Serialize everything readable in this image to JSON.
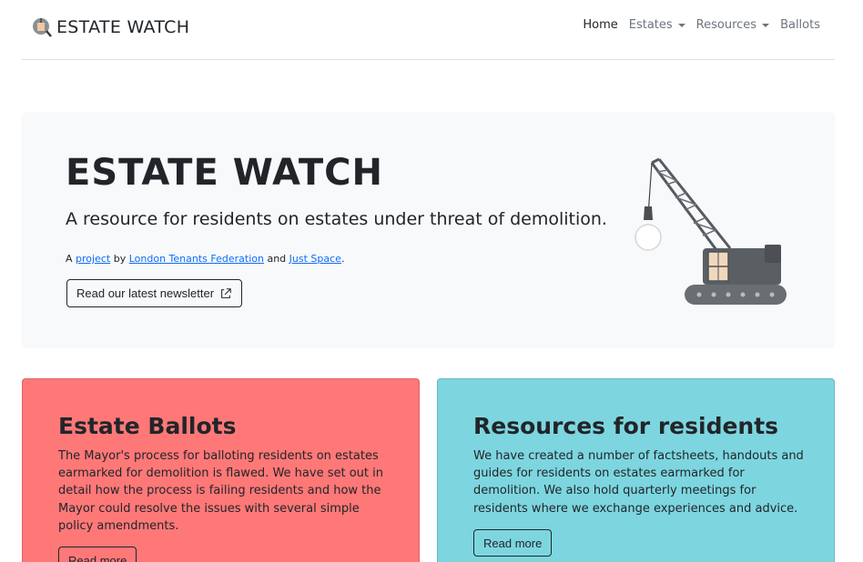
{
  "navbar": {
    "brand": "ESTATE WATCH",
    "items": [
      {
        "label": "Home"
      },
      {
        "label": "Estates"
      },
      {
        "label": "Resources"
      },
      {
        "label": "Ballots"
      }
    ]
  },
  "hero": {
    "title": "ESTATE WATCH",
    "lead": "A resource for residents on estates under threat of demolition.",
    "credit": {
      "prefix": "A",
      "link_project": "project",
      "by": "by",
      "link_ltf": "London Tenants Federation",
      "and": "and",
      "link_justspace": "Just Space",
      "suffix": "."
    },
    "newsletter_button": "Read our latest newsletter"
  },
  "cards": {
    "ballots": {
      "title": "Estate Ballots",
      "text": "The Mayor's process for balloting residents on estates earmarked for demolition is flawed. We have set out in detail how the process is failing residents and how the Mayor could resolve the issues with several simple policy amendments.",
      "button": "Read more"
    },
    "resources": {
      "title": "Resources for residents",
      "text": "We have created a number of factsheets, handouts and guides for residents on estates earmarked for demolition. We also hold quarterly meetings for residents where we exchange experiences and advice.",
      "button": "Read more"
    }
  },
  "colors": {
    "ballots_card": "#ff7878",
    "resources_card": "#7dd6df",
    "hero_bg": "#f8f9fa",
    "link": "#0d6efd"
  },
  "icons": [
    "wrecking-ball-logo-icon",
    "caret-down-icon",
    "external-link-icon",
    "crane-illustration"
  ]
}
